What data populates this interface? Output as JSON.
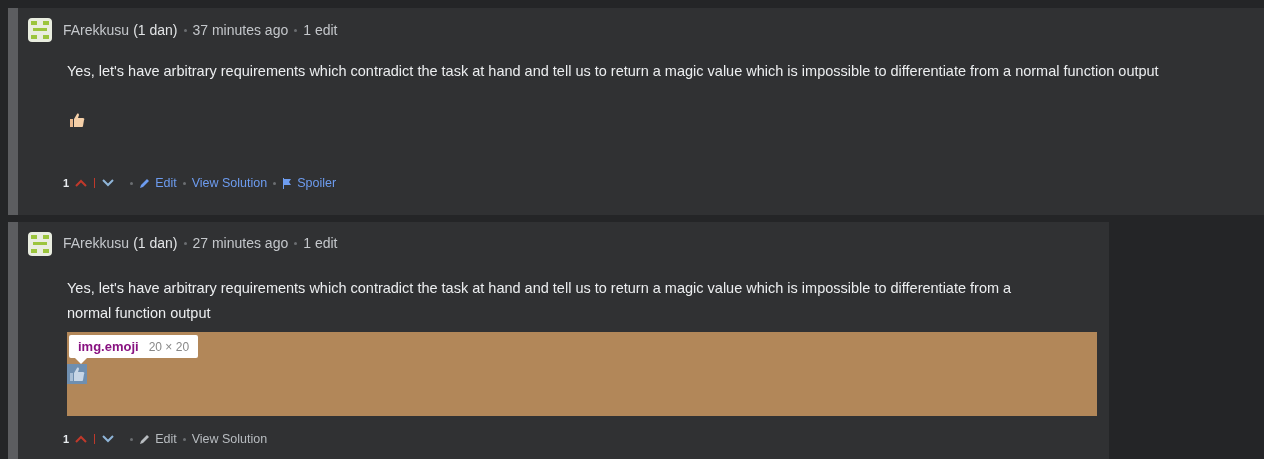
{
  "comments": [
    {
      "author": "FArekkusu",
      "rank": "(1 dan)",
      "time": "37 minutes ago",
      "edits": "1 edit",
      "body": "Yes, let's have arbitrary requirements which contradict the task at hand and tell us to return a magic value which is impossible to differentiate from a normal function output",
      "emoji_highlighted": false,
      "votes": "1",
      "actions": [
        {
          "kind": "edit",
          "label": "Edit"
        },
        {
          "kind": "link",
          "label": "View Solution"
        },
        {
          "kind": "flag",
          "label": "Spoiler"
        }
      ]
    },
    {
      "author": "FArekkusu",
      "rank": "(1 dan)",
      "time": "27 minutes ago",
      "edits": "1 edit",
      "body": "Yes, let's have arbitrary requirements which contradict the task at hand and tell us to return a magic value which is impossible to differentiate from a normal function output",
      "emoji_highlighted": true,
      "inspect_tooltip": {
        "selector": "img.emoji",
        "size": "20 × 20"
      },
      "votes": "1",
      "actions": [
        {
          "kind": "edit",
          "label": "Edit"
        },
        {
          "kind": "plain",
          "label": "View Solution"
        }
      ]
    }
  ]
}
